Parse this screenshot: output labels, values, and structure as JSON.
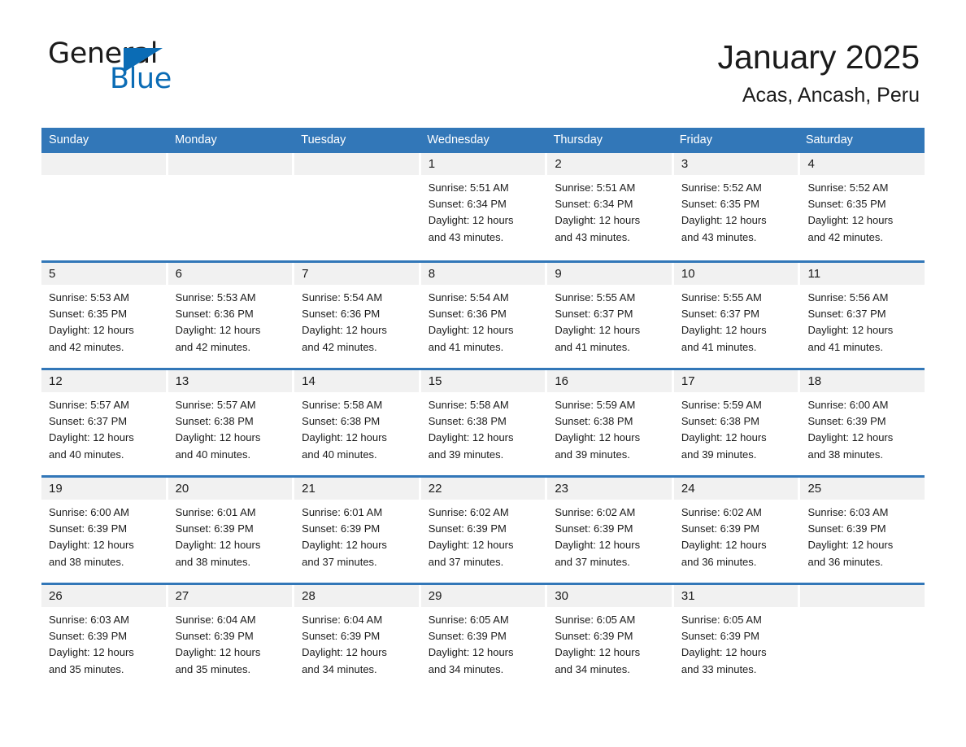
{
  "brand": {
    "logo_primary": "General",
    "logo_secondary": "Blue",
    "triangle_icon": "triangle-icon",
    "accent_color": "#0b6cb5"
  },
  "header": {
    "title": "January 2025",
    "location": "Acas, Ancash, Peru"
  },
  "calendar": {
    "header_bg": "#3277b8",
    "day_strip_bg": "#f1f1f1",
    "weekdays": [
      "Sunday",
      "Monday",
      "Tuesday",
      "Wednesday",
      "Thursday",
      "Friday",
      "Saturday"
    ],
    "weeks": [
      [
        {
          "day": "",
          "sunrise": "",
          "sunset": "",
          "daylight_line1": "",
          "daylight_line2": ""
        },
        {
          "day": "",
          "sunrise": "",
          "sunset": "",
          "daylight_line1": "",
          "daylight_line2": ""
        },
        {
          "day": "",
          "sunrise": "",
          "sunset": "",
          "daylight_line1": "",
          "daylight_line2": ""
        },
        {
          "day": "1",
          "sunrise": "Sunrise: 5:51 AM",
          "sunset": "Sunset: 6:34 PM",
          "daylight_line1": "Daylight: 12 hours",
          "daylight_line2": "and 43 minutes."
        },
        {
          "day": "2",
          "sunrise": "Sunrise: 5:51 AM",
          "sunset": "Sunset: 6:34 PM",
          "daylight_line1": "Daylight: 12 hours",
          "daylight_line2": "and 43 minutes."
        },
        {
          "day": "3",
          "sunrise": "Sunrise: 5:52 AM",
          "sunset": "Sunset: 6:35 PM",
          "daylight_line1": "Daylight: 12 hours",
          "daylight_line2": "and 43 minutes."
        },
        {
          "day": "4",
          "sunrise": "Sunrise: 5:52 AM",
          "sunset": "Sunset: 6:35 PM",
          "daylight_line1": "Daylight: 12 hours",
          "daylight_line2": "and 42 minutes."
        }
      ],
      [
        {
          "day": "5",
          "sunrise": "Sunrise: 5:53 AM",
          "sunset": "Sunset: 6:35 PM",
          "daylight_line1": "Daylight: 12 hours",
          "daylight_line2": "and 42 minutes."
        },
        {
          "day": "6",
          "sunrise": "Sunrise: 5:53 AM",
          "sunset": "Sunset: 6:36 PM",
          "daylight_line1": "Daylight: 12 hours",
          "daylight_line2": "and 42 minutes."
        },
        {
          "day": "7",
          "sunrise": "Sunrise: 5:54 AM",
          "sunset": "Sunset: 6:36 PM",
          "daylight_line1": "Daylight: 12 hours",
          "daylight_line2": "and 42 minutes."
        },
        {
          "day": "8",
          "sunrise": "Sunrise: 5:54 AM",
          "sunset": "Sunset: 6:36 PM",
          "daylight_line1": "Daylight: 12 hours",
          "daylight_line2": "and 41 minutes."
        },
        {
          "day": "9",
          "sunrise": "Sunrise: 5:55 AM",
          "sunset": "Sunset: 6:37 PM",
          "daylight_line1": "Daylight: 12 hours",
          "daylight_line2": "and 41 minutes."
        },
        {
          "day": "10",
          "sunrise": "Sunrise: 5:55 AM",
          "sunset": "Sunset: 6:37 PM",
          "daylight_line1": "Daylight: 12 hours",
          "daylight_line2": "and 41 minutes."
        },
        {
          "day": "11",
          "sunrise": "Sunrise: 5:56 AM",
          "sunset": "Sunset: 6:37 PM",
          "daylight_line1": "Daylight: 12 hours",
          "daylight_line2": "and 41 minutes."
        }
      ],
      [
        {
          "day": "12",
          "sunrise": "Sunrise: 5:57 AM",
          "sunset": "Sunset: 6:37 PM",
          "daylight_line1": "Daylight: 12 hours",
          "daylight_line2": "and 40 minutes."
        },
        {
          "day": "13",
          "sunrise": "Sunrise: 5:57 AM",
          "sunset": "Sunset: 6:38 PM",
          "daylight_line1": "Daylight: 12 hours",
          "daylight_line2": "and 40 minutes."
        },
        {
          "day": "14",
          "sunrise": "Sunrise: 5:58 AM",
          "sunset": "Sunset: 6:38 PM",
          "daylight_line1": "Daylight: 12 hours",
          "daylight_line2": "and 40 minutes."
        },
        {
          "day": "15",
          "sunrise": "Sunrise: 5:58 AM",
          "sunset": "Sunset: 6:38 PM",
          "daylight_line1": "Daylight: 12 hours",
          "daylight_line2": "and 39 minutes."
        },
        {
          "day": "16",
          "sunrise": "Sunrise: 5:59 AM",
          "sunset": "Sunset: 6:38 PM",
          "daylight_line1": "Daylight: 12 hours",
          "daylight_line2": "and 39 minutes."
        },
        {
          "day": "17",
          "sunrise": "Sunrise: 5:59 AM",
          "sunset": "Sunset: 6:38 PM",
          "daylight_line1": "Daylight: 12 hours",
          "daylight_line2": "and 39 minutes."
        },
        {
          "day": "18",
          "sunrise": "Sunrise: 6:00 AM",
          "sunset": "Sunset: 6:39 PM",
          "daylight_line1": "Daylight: 12 hours",
          "daylight_line2": "and 38 minutes."
        }
      ],
      [
        {
          "day": "19",
          "sunrise": "Sunrise: 6:00 AM",
          "sunset": "Sunset: 6:39 PM",
          "daylight_line1": "Daylight: 12 hours",
          "daylight_line2": "and 38 minutes."
        },
        {
          "day": "20",
          "sunrise": "Sunrise: 6:01 AM",
          "sunset": "Sunset: 6:39 PM",
          "daylight_line1": "Daylight: 12 hours",
          "daylight_line2": "and 38 minutes."
        },
        {
          "day": "21",
          "sunrise": "Sunrise: 6:01 AM",
          "sunset": "Sunset: 6:39 PM",
          "daylight_line1": "Daylight: 12 hours",
          "daylight_line2": "and 37 minutes."
        },
        {
          "day": "22",
          "sunrise": "Sunrise: 6:02 AM",
          "sunset": "Sunset: 6:39 PM",
          "daylight_line1": "Daylight: 12 hours",
          "daylight_line2": "and 37 minutes."
        },
        {
          "day": "23",
          "sunrise": "Sunrise: 6:02 AM",
          "sunset": "Sunset: 6:39 PM",
          "daylight_line1": "Daylight: 12 hours",
          "daylight_line2": "and 37 minutes."
        },
        {
          "day": "24",
          "sunrise": "Sunrise: 6:02 AM",
          "sunset": "Sunset: 6:39 PM",
          "daylight_line1": "Daylight: 12 hours",
          "daylight_line2": "and 36 minutes."
        },
        {
          "day": "25",
          "sunrise": "Sunrise: 6:03 AM",
          "sunset": "Sunset: 6:39 PM",
          "daylight_line1": "Daylight: 12 hours",
          "daylight_line2": "and 36 minutes."
        }
      ],
      [
        {
          "day": "26",
          "sunrise": "Sunrise: 6:03 AM",
          "sunset": "Sunset: 6:39 PM",
          "daylight_line1": "Daylight: 12 hours",
          "daylight_line2": "and 35 minutes."
        },
        {
          "day": "27",
          "sunrise": "Sunrise: 6:04 AM",
          "sunset": "Sunset: 6:39 PM",
          "daylight_line1": "Daylight: 12 hours",
          "daylight_line2": "and 35 minutes."
        },
        {
          "day": "28",
          "sunrise": "Sunrise: 6:04 AM",
          "sunset": "Sunset: 6:39 PM",
          "daylight_line1": "Daylight: 12 hours",
          "daylight_line2": "and 34 minutes."
        },
        {
          "day": "29",
          "sunrise": "Sunrise: 6:05 AM",
          "sunset": "Sunset: 6:39 PM",
          "daylight_line1": "Daylight: 12 hours",
          "daylight_line2": "and 34 minutes."
        },
        {
          "day": "30",
          "sunrise": "Sunrise: 6:05 AM",
          "sunset": "Sunset: 6:39 PM",
          "daylight_line1": "Daylight: 12 hours",
          "daylight_line2": "and 34 minutes."
        },
        {
          "day": "31",
          "sunrise": "Sunrise: 6:05 AM",
          "sunset": "Sunset: 6:39 PM",
          "daylight_line1": "Daylight: 12 hours",
          "daylight_line2": "and 33 minutes."
        },
        {
          "day": "",
          "sunrise": "",
          "sunset": "",
          "daylight_line1": "",
          "daylight_line2": ""
        }
      ]
    ]
  }
}
